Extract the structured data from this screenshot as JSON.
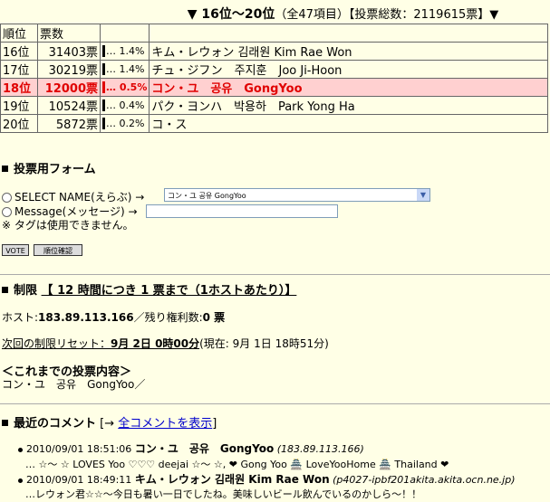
{
  "header": {
    "range": "▼ 16位～20位",
    "summary": "（全47項目）【投票総数：2119615票】▼"
  },
  "table": {
    "headers": [
      "順位",
      "票数",
      "",
      ""
    ],
    "rows": [
      {
        "rank": "16位",
        "votes": "31403票",
        "pct": "… 1.4%",
        "name": "キム・レウォン 김래원 Kim Rae Won"
      },
      {
        "rank": "17位",
        "votes": "30219票",
        "pct": "… 1.4%",
        "name": "チュ・ジフン　주지훈　Joo Ji-Hoon"
      },
      {
        "rank": "18位",
        "votes": "12000票",
        "pct": "… 0.5%",
        "name": "コン・ユ　공유　GongYoo"
      },
      {
        "rank": "19位",
        "votes": "10524票",
        "pct": "… 0.4%",
        "name": "パク・ヨンハ　박용하　Park Yong Ha"
      },
      {
        "rank": "20位",
        "votes": "5872票",
        "pct": "… 0.2%",
        "name": "コ・ス"
      }
    ]
  },
  "form": {
    "title": "投票用フォーム",
    "select_label": "SELECT NAME(えらぶ) →",
    "select_value": "コン・ユ 공유 GongYoo",
    "message_label": "Message(メッセージ) →",
    "note": "※ タグは使用できません。",
    "vote_button": "VOTE",
    "rank_button": "順位確認"
  },
  "limit": {
    "title": "制限",
    "rule": "【 12 時間につき 1 票まで（1ホストあたり）】",
    "host_label": "ホスト:",
    "host_value": "183.89.113.166",
    "remaining_label": "／残り権利数:",
    "remaining_value": "0 票",
    "reset_label": "次回の制限リセット：",
    "reset_value": "9月 2日 0時00分",
    "current": "(現在: 9月 1日 18時51分)",
    "history_title": "＜これまでの投票内容＞",
    "history_value": "コン・ユ　공유　GongYoo／"
  },
  "comments": {
    "title": "最近のコメント",
    "link_prefix": "[→",
    "link_text": "全コメントを表示",
    "link_suffix": "]",
    "items": [
      {
        "time": "2010/09/01 18:51:06",
        "name": "コン・ユ　공유　GongYoo",
        "host": "(183.89.113.166)",
        "text": "… ☆〜 ☆ LOVES Yoo ♡♡♡ deejai ☆〜 ☆, ❤ Gong Yoo 🏯 LoveYooHome 🏯 Thailand ❤"
      },
      {
        "time": "2010/09/01 18:49:11",
        "name": "キム・レウォン 김래원 Kim Rae Won",
        "host": "(p4027-ipbf201akita.akita.ocn.ne.jp)",
        "text": "…レウォン君☆☆〜今日も暑い一日でしたね。美味しいビール飲んでいるのかしら〜！！"
      }
    ]
  }
}
